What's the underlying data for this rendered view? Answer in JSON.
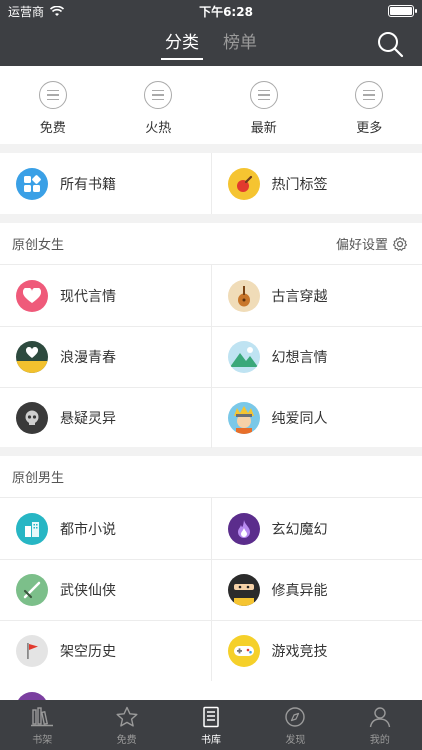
{
  "status": {
    "carrier": "运营商",
    "time": "下午6:28",
    "battery_level": 1.0
  },
  "header": {
    "tabs": [
      {
        "label": "分类",
        "active": true
      },
      {
        "label": "榜单",
        "active": false
      }
    ]
  },
  "quick": [
    {
      "label": "免费"
    },
    {
      "label": "火热"
    },
    {
      "label": "最新"
    },
    {
      "label": "更多"
    }
  ],
  "top_categories": [
    {
      "label": "所有书籍",
      "icon": "grid-icon",
      "color": "#3aa0e6"
    },
    {
      "label": "热门标签",
      "icon": "fire-icon",
      "color": "#f5c431"
    }
  ],
  "female": {
    "title": "原创女生",
    "pref_label": "偏好设置",
    "items": [
      {
        "label": "现代言情",
        "icon": "heart-icon",
        "color": "#ef5a7a"
      },
      {
        "label": "古言穿越",
        "icon": "lute-icon",
        "color": "#f0dcb8"
      },
      {
        "label": "浪漫青春",
        "icon": "heart-field-icon",
        "color": "#2d4a3e"
      },
      {
        "label": "幻想言情",
        "icon": "mountain-icon",
        "color": "#bfe3f2"
      },
      {
        "label": "悬疑灵异",
        "icon": "skull-icon",
        "color": "#3a3a3a"
      },
      {
        "label": "纯爱同人",
        "icon": "ninja-icon",
        "color": "#7ac8e8"
      }
    ]
  },
  "male": {
    "title": "原创男生",
    "items": [
      {
        "label": "都市小说",
        "icon": "city-icon",
        "color": "#27b6c4"
      },
      {
        "label": "玄幻魔幻",
        "icon": "flame-icon",
        "color": "#5b2d8c"
      },
      {
        "label": "武侠仙侠",
        "icon": "sword-icon",
        "color": "#7cbf8a"
      },
      {
        "label": "修真异能",
        "icon": "masked-icon",
        "color": "#2b2b2b"
      },
      {
        "label": "架空历史",
        "icon": "flag-icon",
        "color": "#e4e4e4"
      },
      {
        "label": "游戏竞技",
        "icon": "gamepad-icon",
        "color": "#f5d02a"
      }
    ]
  },
  "bottom_nav": [
    {
      "label": "书架",
      "icon": "bookshelf-icon",
      "active": false
    },
    {
      "label": "免费",
      "icon": "star-icon",
      "active": false
    },
    {
      "label": "书库",
      "icon": "library-icon",
      "active": true
    },
    {
      "label": "发现",
      "icon": "compass-icon",
      "active": false
    },
    {
      "label": "我的",
      "icon": "user-icon",
      "active": false
    }
  ]
}
